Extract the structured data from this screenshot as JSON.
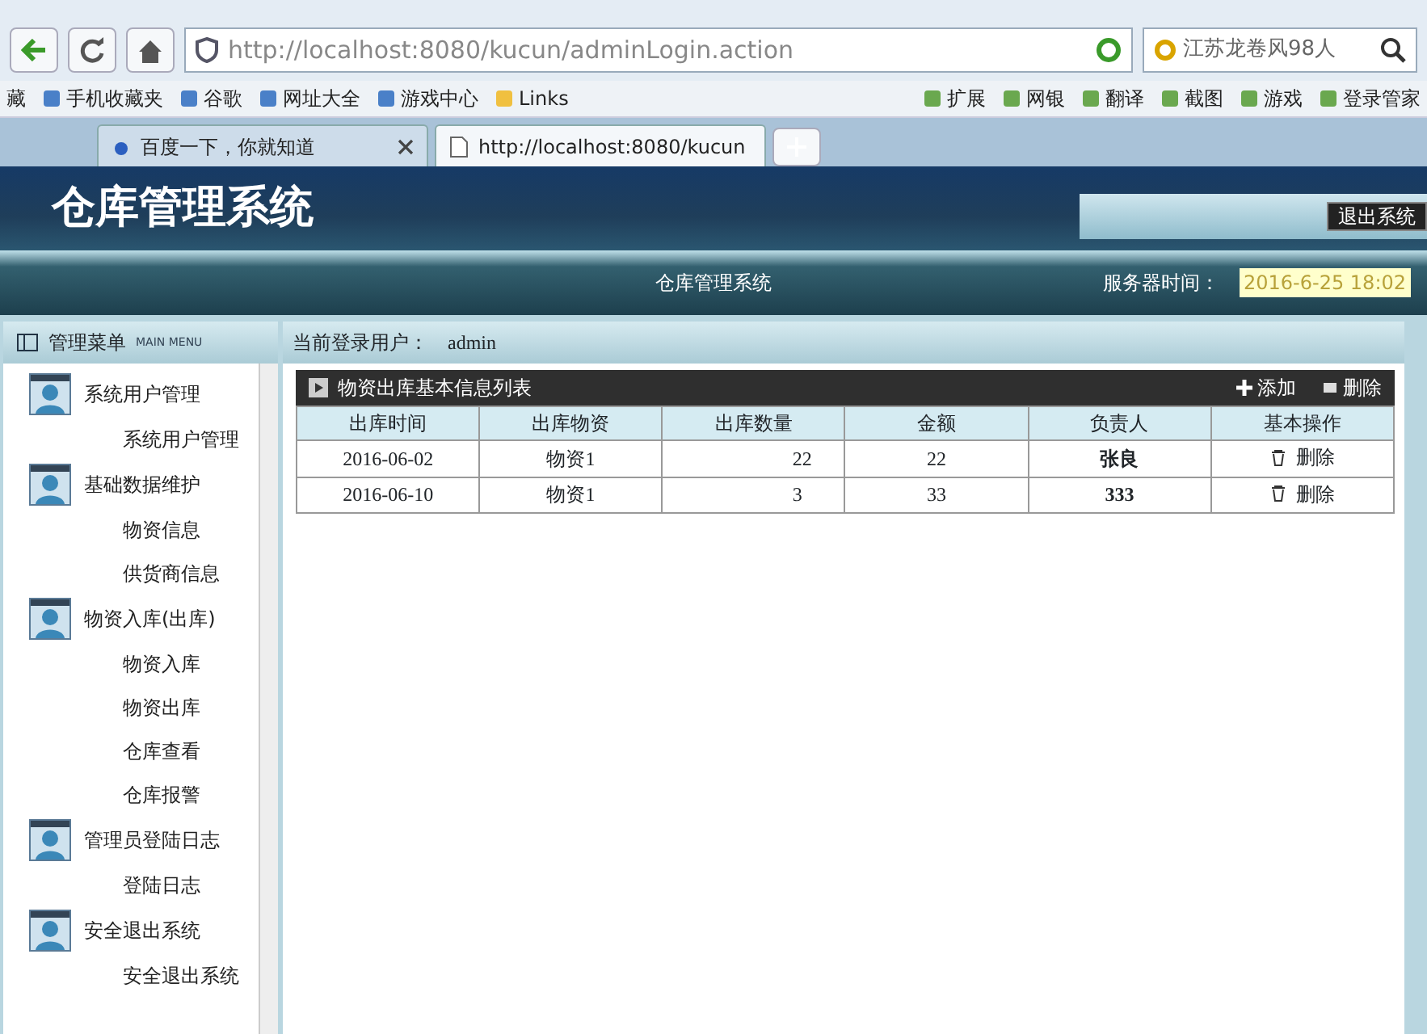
{
  "browser": {
    "url": "http://localhost:8080/kucun/adminLogin.action",
    "search_value": "江苏龙卷风98人",
    "bookmarks": [
      "藏",
      "手机收藏夹",
      "谷歌",
      "网址大全",
      "游戏中心",
      "Links"
    ],
    "extensions": [
      "扩展",
      "网银",
      "翻译",
      "截图",
      "游戏",
      "登录管家"
    ],
    "tabs": [
      {
        "label": "百度一下，你就知道",
        "selected": false
      },
      {
        "label": "http://localhost:8080/kucun",
        "selected": true
      }
    ]
  },
  "app": {
    "title": "仓库管理系统",
    "logout": "退出系统",
    "subtitle": "仓库管理系统",
    "server_time_label": "服务器时间：",
    "server_time": "2016-6-25 18:02"
  },
  "sidebar": {
    "title": "管理菜单",
    "subtitle": "MAIN MENU",
    "groups": [
      {
        "label": "系统用户管理",
        "children": [
          {
            "label": "系统用户管理"
          }
        ]
      },
      {
        "label": "基础数据维护",
        "children": [
          {
            "label": "物资信息"
          },
          {
            "label": "供货商信息"
          }
        ]
      },
      {
        "label": "物资入库(出库)",
        "children": [
          {
            "label": "物资入库"
          },
          {
            "label": "物资出库"
          },
          {
            "label": "仓库查看"
          },
          {
            "label": "仓库报警"
          }
        ]
      },
      {
        "label": "管理员登陆日志",
        "children": [
          {
            "label": "登陆日志"
          }
        ]
      },
      {
        "label": "安全退出系统",
        "children": [
          {
            "label": "安全退出系统"
          }
        ]
      }
    ]
  },
  "user": {
    "label": "当前登录用户：",
    "name": "admin"
  },
  "panel": {
    "title": "物资出库基本信息列表",
    "actions": [
      "添加",
      "删除"
    ],
    "table": {
      "columns": [
        "出库时间",
        "出库物资",
        "出库数量",
        "金额",
        "负责人",
        "基本操作"
      ],
      "rows": [
        {
          "cells": [
            "2016-06-02",
            "物资1",
            "22",
            "22",
            "张良"
          ],
          "action": "删除"
        },
        {
          "cells": [
            "2016-06-10",
            "物资1",
            "3",
            "33",
            "333"
          ],
          "action": "删除"
        }
      ]
    }
  }
}
